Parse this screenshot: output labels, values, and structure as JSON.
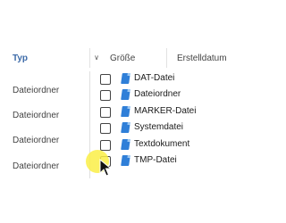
{
  "header": {
    "type_label": "Typ",
    "size_label": "Größe",
    "created_label": "Erstelldatum"
  },
  "left_column": {
    "items": [
      "Dateiordner",
      "Dateiordner",
      "Dateiordner",
      "Dateiordner"
    ]
  },
  "filter_menu": {
    "items": [
      {
        "label": "DAT-Datei",
        "checked": false,
        "icon": "file-icon"
      },
      {
        "label": "Dateiordner",
        "checked": false,
        "icon": "file-icon"
      },
      {
        "label": "MARKER-Datei",
        "checked": false,
        "icon": "file-icon"
      },
      {
        "label": "Systemdatei",
        "checked": false,
        "icon": "file-icon"
      },
      {
        "label": "Textdokument",
        "checked": false,
        "icon": "file-icon"
      },
      {
        "label": "TMP-Datei",
        "checked": false,
        "icon": "file-icon"
      }
    ]
  },
  "colors": {
    "accent": "#3c6aa8",
    "file_icon": "#2f7fd8",
    "cursor_highlight": "#faee46"
  }
}
